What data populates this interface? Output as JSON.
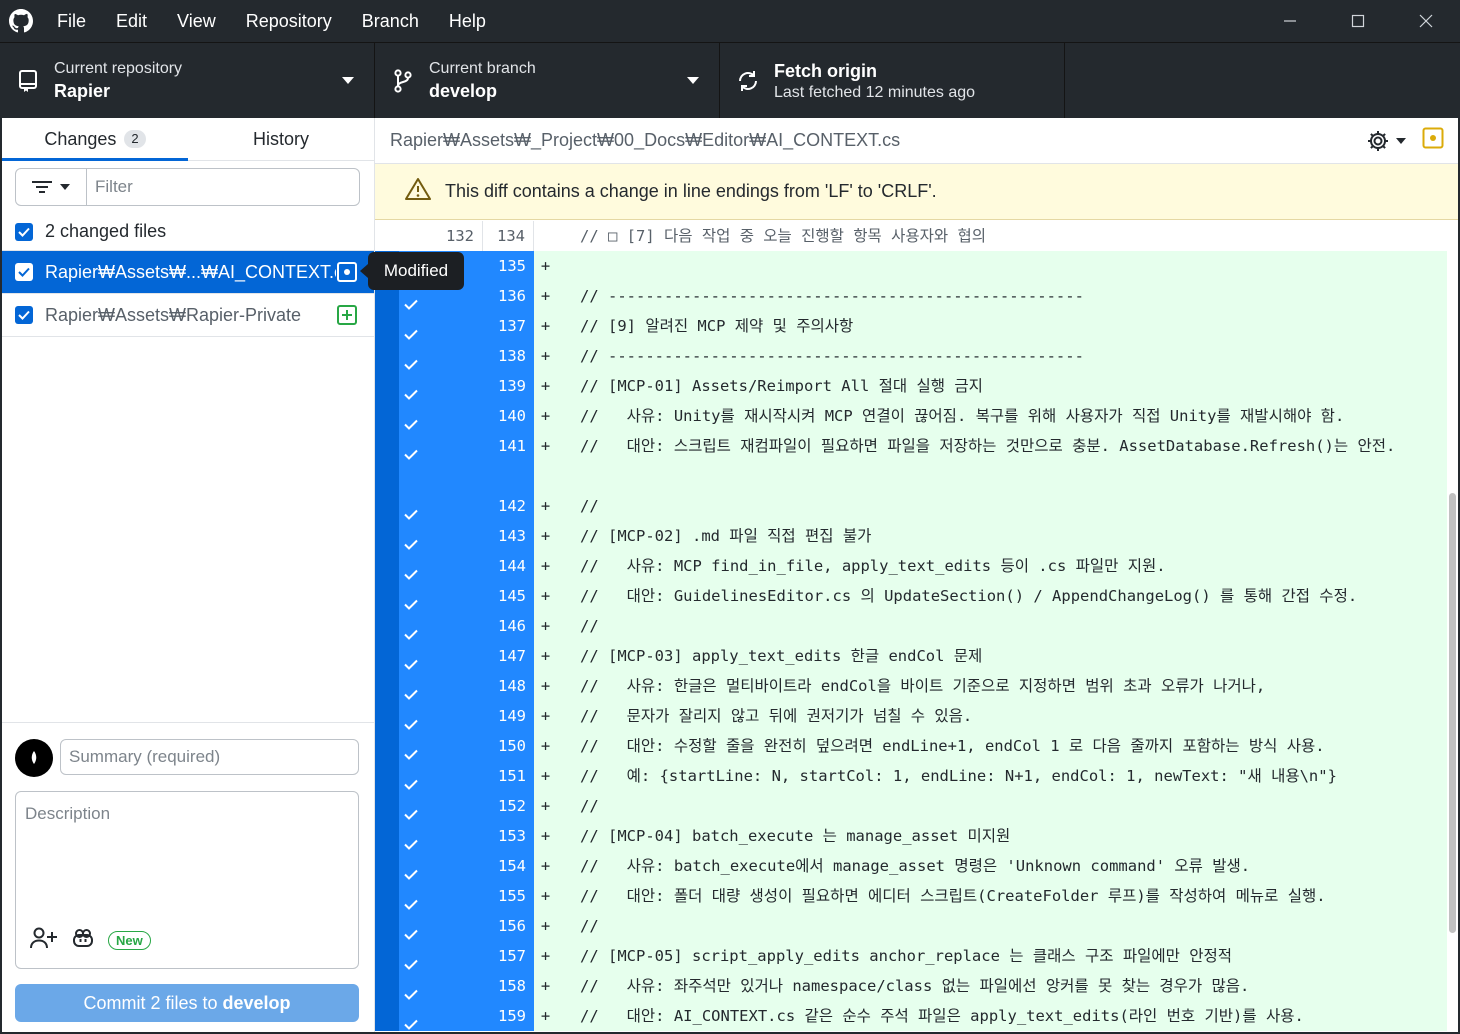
{
  "menu": [
    "File",
    "Edit",
    "View",
    "Repository",
    "Branch",
    "Help"
  ],
  "toolbar": {
    "repo_label": "Current repository",
    "repo_name": "Rapier",
    "branch_label": "Current branch",
    "branch_name": "develop",
    "fetch_title": "Fetch origin",
    "fetch_sub": "Last fetched 12 minutes ago"
  },
  "tabs": {
    "changes": "Changes",
    "changes_count": "2",
    "history": "History"
  },
  "filter": {
    "placeholder": "Filter"
  },
  "changed_files_label": "2 changed files",
  "files": [
    {
      "name": "Rapier₩Assets₩...₩AI_CONTEXT.cs",
      "status": "modified"
    },
    {
      "name": "Rapier₩Assets₩Rapier-Private",
      "status": "added"
    }
  ],
  "tooltip": "Modified",
  "commit": {
    "summary_placeholder": "Summary (required)",
    "description_placeholder": "Description",
    "new_badge": "New",
    "button_prefix": "Commit 2 files to",
    "button_branch": "develop"
  },
  "diff": {
    "path": "Rapier₩Assets₩_Project₩00_Docs₩Editor₩AI_CONTEXT.cs",
    "warning": "This diff contains a change in line endings from 'LF' to 'CRLF'.",
    "lines": [
      {
        "type": "ctx",
        "old": "132",
        "new": "134",
        "sign": "",
        "text": "// □ [7] 다음 작업 중 오늘 진행할 항목 사용자와 협의"
      },
      {
        "type": "add",
        "old": "",
        "new": "135",
        "sign": "+",
        "text": ""
      },
      {
        "type": "add",
        "old": "",
        "new": "136",
        "sign": "+",
        "text": "// ---------------------------------------------------"
      },
      {
        "type": "add",
        "old": "",
        "new": "137",
        "sign": "+",
        "text": "// [9] 알려진 MCP 제약 및 주의사항"
      },
      {
        "type": "add",
        "old": "",
        "new": "138",
        "sign": "+",
        "text": "// ---------------------------------------------------"
      },
      {
        "type": "add",
        "old": "",
        "new": "139",
        "sign": "+",
        "text": "// [MCP-01] Assets/Reimport All 절대 실행 금지"
      },
      {
        "type": "add",
        "old": "",
        "new": "140",
        "sign": "+",
        "text": "//   사유: Unity를 재시작시켜 MCP 연결이 끊어짐. 복구를 위해 사용자가 직접 Unity를 재발시해야 함."
      },
      {
        "type": "add",
        "old": "",
        "new": "141",
        "sign": "+",
        "text": "//   대안: 스크립트 재컴파일이 필요하면 파일을 저장하는 것만으로 충분. AssetDatabase.Refresh()는 안전.",
        "wrap": true
      },
      {
        "type": "add",
        "old": "",
        "new": "142",
        "sign": "+",
        "text": "//"
      },
      {
        "type": "add",
        "old": "",
        "new": "143",
        "sign": "+",
        "text": "// [MCP-02] .md 파일 직접 편집 불가"
      },
      {
        "type": "add",
        "old": "",
        "new": "144",
        "sign": "+",
        "text": "//   사유: MCP find_in_file, apply_text_edits 등이 .cs 파일만 지원."
      },
      {
        "type": "add",
        "old": "",
        "new": "145",
        "sign": "+",
        "text": "//   대안: GuidelinesEditor.cs 의 UpdateSection() / AppendChangeLog() 를 통해 간접 수정."
      },
      {
        "type": "add",
        "old": "",
        "new": "146",
        "sign": "+",
        "text": "//"
      },
      {
        "type": "add",
        "old": "",
        "new": "147",
        "sign": "+",
        "text": "// [MCP-03] apply_text_edits 한글 endCol 문제"
      },
      {
        "type": "add",
        "old": "",
        "new": "148",
        "sign": "+",
        "text": "//   사유: 한글은 멀티바이트라 endCol을 바이트 기준으로 지정하면 범위 초과 오류가 나거나,"
      },
      {
        "type": "add",
        "old": "",
        "new": "149",
        "sign": "+",
        "text": "//   문자가 잘리지 않고 뒤에 권저기가 넘칠 수 있음."
      },
      {
        "type": "add",
        "old": "",
        "new": "150",
        "sign": "+",
        "text": "//   대안: 수정할 줄을 완전히 덮으려면 endLine+1, endCol 1 로 다음 줄까지 포함하는 방식 사용."
      },
      {
        "type": "add",
        "old": "",
        "new": "151",
        "sign": "+",
        "text": "//   예: {startLine: N, startCol: 1, endLine: N+1, endCol: 1, newText: \"새 내용\\n\"}"
      },
      {
        "type": "add",
        "old": "",
        "new": "152",
        "sign": "+",
        "text": "//"
      },
      {
        "type": "add",
        "old": "",
        "new": "153",
        "sign": "+",
        "text": "// [MCP-04] batch_execute 는 manage_asset 미지원"
      },
      {
        "type": "add",
        "old": "",
        "new": "154",
        "sign": "+",
        "text": "//   사유: batch_execute에서 manage_asset 명령은 'Unknown command' 오류 발생."
      },
      {
        "type": "add",
        "old": "",
        "new": "155",
        "sign": "+",
        "text": "//   대안: 폴더 대량 생성이 필요하면 에디터 스크립트(CreateFolder 루프)를 작성하여 메뉴로 실행."
      },
      {
        "type": "add",
        "old": "",
        "new": "156",
        "sign": "+",
        "text": "//"
      },
      {
        "type": "add",
        "old": "",
        "new": "157",
        "sign": "+",
        "text": "// [MCP-05] script_apply_edits anchor_replace 는 클래스 구조 파일에만 안정적"
      },
      {
        "type": "add",
        "old": "",
        "new": "158",
        "sign": "+",
        "text": "//   사유: 좌주석만 있거나 namespace/class 없는 파일에선 앙커를 못 찾는 경우가 많음."
      },
      {
        "type": "add",
        "old": "",
        "new": "159",
        "sign": "+",
        "text": "//   대안: AI_CONTEXT.cs 같은 순수 주석 파일은 apply_text_edits(라인 번호 기반)를 사용."
      }
    ]
  },
  "colors": {
    "accent": "#0366d6",
    "added_bg": "#e6ffed",
    "warning_bg": "#fffbdd",
    "titlebar": "#24292e"
  }
}
